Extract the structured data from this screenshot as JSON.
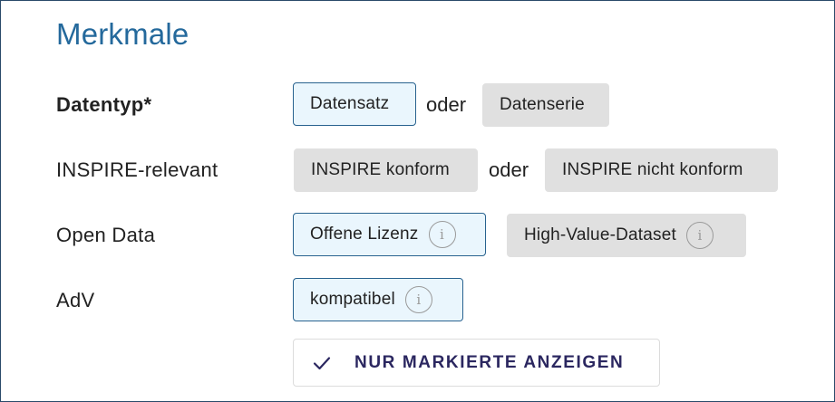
{
  "section": {
    "title": "Merkmale"
  },
  "rows": {
    "datentyp": {
      "label": "Datentyp*",
      "option1": "Datensatz",
      "separator": "oder",
      "option2": "Datenserie"
    },
    "inspire": {
      "label": "INSPIRE-relevant",
      "option1": "INSPIRE konform",
      "separator": "oder",
      "option2": "INSPIRE nicht konform"
    },
    "open_data": {
      "label": "Open Data",
      "option1": "Offene Lizenz",
      "option2": "High-Value-Dataset"
    },
    "adv": {
      "label": "AdV",
      "option1": "kompatibel"
    }
  },
  "filter_button": {
    "label": "NUR MARKIERTE ANZEIGEN",
    "icon": "check-icon"
  },
  "icons": {
    "info": "info-icon",
    "info_glyph": "i"
  },
  "colors": {
    "title": "#24699c",
    "selected_bg": "#eaf6fd",
    "selected_border": "#28628f",
    "unselected_bg": "#e0e0e0",
    "button_text": "#2b2760"
  }
}
